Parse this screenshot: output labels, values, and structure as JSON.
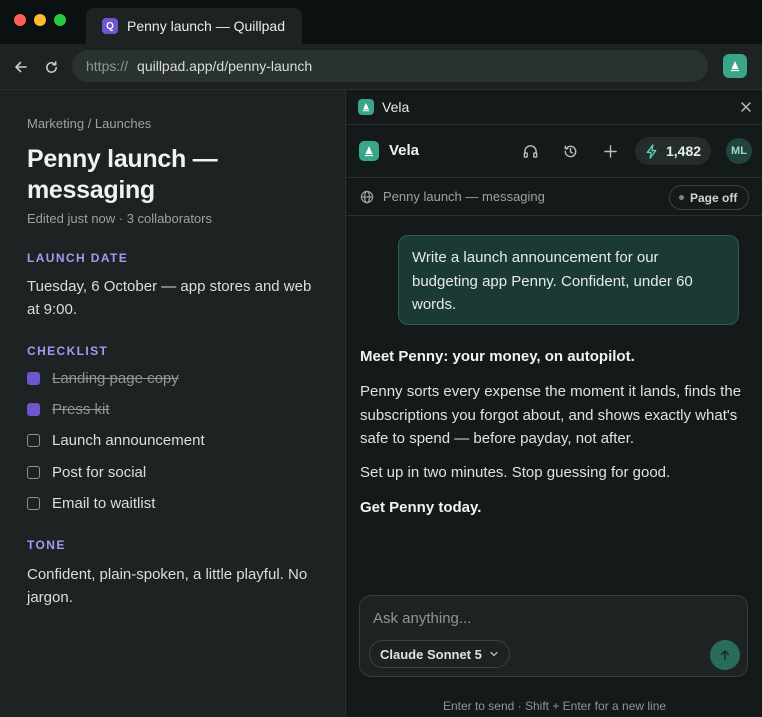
{
  "browser": {
    "tab_title": "Penny launch — Quillpad",
    "tab_favicon_letter": "Q",
    "url_scheme": "https://",
    "url_host": "quillpad.app/d/penny-launch"
  },
  "doc": {
    "breadcrumb": "Marketing / Launches",
    "title": "Penny launch — messaging",
    "meta": "Edited just now · 3 collaborators",
    "launch_heading": "LAUNCH DATE",
    "launch_text": "Tuesday, 6 October — app stores and web at 9:00.",
    "checklist_heading": "CHECKLIST",
    "checklist": [
      {
        "label": "Landing page copy",
        "checked": true
      },
      {
        "label": "Press kit",
        "checked": true
      },
      {
        "label": "Launch announcement",
        "checked": false
      },
      {
        "label": "Post for social",
        "checked": false
      },
      {
        "label": "Email to waitlist",
        "checked": false
      }
    ],
    "tone_heading": "TONE",
    "tone_text": "Confident, plain-spoken, a little playful. No jargon."
  },
  "panel": {
    "top_title": "Vela",
    "name": "Vela",
    "credits": "1,482",
    "avatar": "ML",
    "context": "Penny launch — messaging",
    "page_toggle": "Page off",
    "user_message": "Write a launch announcement for our budgeting app Penny. Confident, under 60 words.",
    "response": {
      "headline": "Meet Penny: your money, on autopilot.",
      "p1": "Penny sorts every expense the moment it lands, finds the subscriptions you forgot about, and shows exactly what's safe to spend — before payday, not after.",
      "p2": "Set up in two minutes. Stop guessing for good.",
      "cta": "Get Penny today."
    },
    "composer_placeholder": "Ask anything...",
    "model": "Claude Sonnet 5",
    "hint": "Enter to send · Shift + Enter for a new line"
  },
  "colors": {
    "accent_purple": "#6e56cf",
    "accent_green": "#3aa58a",
    "section_heading": "#a898f5"
  },
  "icons": [
    "back-arrow-icon",
    "reload-icon",
    "extension-icon",
    "sailboat-icon",
    "close-icon",
    "headphones-icon",
    "history-icon",
    "plus-icon",
    "bolt-icon",
    "globe-icon",
    "chevron-down-icon",
    "arrow-up-icon"
  ]
}
